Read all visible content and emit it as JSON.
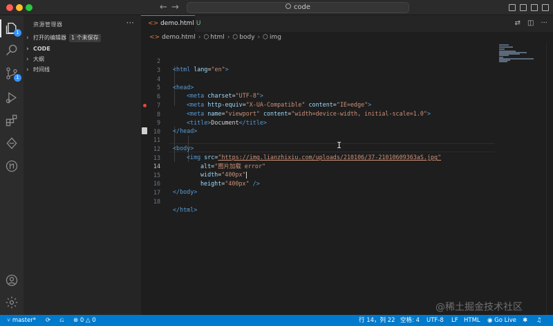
{
  "titlebar": {
    "command_center": "code",
    "back_arrow": "←",
    "forward_arrow": "→"
  },
  "activity_bar": {
    "explorer_badge": "1",
    "scm_badge": "1"
  },
  "sidebar": {
    "title": "资源管理器",
    "more": "···",
    "sections": [
      {
        "label": "打开的编辑器",
        "badge": "1 个未保存"
      },
      {
        "label": "CODE"
      },
      {
        "label": "大纲"
      },
      {
        "label": "时间线"
      }
    ]
  },
  "tabs": [
    {
      "label": "demo.html",
      "status": "U"
    }
  ],
  "breadcrumb": {
    "file": "demo.html",
    "items": [
      "html",
      "body",
      "img"
    ],
    "sep": "›"
  },
  "code_lines": [
    {
      "n": "2"
    },
    {
      "n": "3"
    },
    {
      "n": "4"
    },
    {
      "n": "5"
    },
    {
      "n": "6"
    },
    {
      "n": "7"
    },
    {
      "n": "8"
    },
    {
      "n": "9"
    },
    {
      "n": "10"
    },
    {
      "n": "11"
    },
    {
      "n": "12"
    },
    {
      "n": "13"
    },
    {
      "n": "14"
    },
    {
      "n": "15"
    },
    {
      "n": "16"
    },
    {
      "n": "17"
    },
    {
      "n": "18"
    }
  ],
  "code": {
    "l2_tag": "<html",
    "l2_attr": "lang",
    "l2_eq": "=",
    "l2_val": "\"en\"",
    "l2_end": ">",
    "l4": "<head>",
    "l5_tag": "<meta",
    "l5_attr": "charset",
    "l5_val": "\"UTF-8\"",
    "l5_end": ">",
    "l6_tag": "<meta",
    "l6_attr1": "http-equiv",
    "l6_val1": "\"X-UA-Compatible\"",
    "l6_attr2": "content",
    "l6_val2": "\"IE=edge\"",
    "l6_end": ">",
    "l7_tag": "<meta",
    "l7_attr1": "name",
    "l7_val1": "\"viewport\"",
    "l7_attr2": "content",
    "l7_val2": "\"width=device-width, initial-scale=1.0\"",
    "l7_end": ">",
    "l8_open": "<title>",
    "l8_text": "Document",
    "l8_close": "</title>",
    "l9": "</head>",
    "l11": "<body>",
    "l12_tag": "<img",
    "l12_attr": "src",
    "l12_val": "\"https://img.lianzhixiu.com/uploads/210106/37-21010609363aS.jpg\"",
    "l13_attr": "alt",
    "l13_val": "\"图片加载 error\"",
    "l14_attr": "width",
    "l14_val": "\"400px\"",
    "l15_attr": "height",
    "l15_val": "\"400px\"",
    "l15_end": "/>",
    "l16": "</body>",
    "l18": "</html>",
    "eq": "="
  },
  "statusbar": {
    "branch": "master*",
    "sync": "⟳",
    "errors": "0",
    "warnings": "0",
    "position": "行 14，列 22",
    "indent": "空格: 4",
    "encoding": "UTF-8",
    "eol": "LF",
    "language": "HTML",
    "golive": "Go Live"
  },
  "watermark": "@稀土掘金技术社区"
}
